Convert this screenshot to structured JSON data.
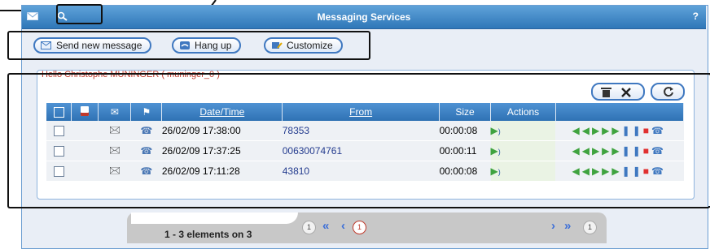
{
  "window": {
    "title": "Messaging Services",
    "help": "?"
  },
  "toolbar": {
    "send_label": "Send new message",
    "hangup_label": "Hang up",
    "customize_label": "Customize"
  },
  "greeting": "Hello Christophe MUNINGER ( muninger_0 )",
  "table": {
    "headers": {
      "date": "Date/Time",
      "from": "From",
      "size": "Size",
      "actions": "Actions"
    },
    "rows": [
      {
        "date": "26/02/09 17:38:00",
        "from": "78353",
        "size": "00:00:08"
      },
      {
        "date": "26/02/09 17:37:25",
        "from": "00630074761",
        "size": "00:00:11"
      },
      {
        "date": "26/02/09 17:11:28",
        "from": "43810",
        "size": "00:00:08"
      }
    ]
  },
  "pager": {
    "summary": "1 - 3 elements on 3",
    "first_page": "1",
    "current_page": "1",
    "last_page": "1"
  },
  "colors": {
    "accent": "#2f77b8",
    "greeting": "#c0392b",
    "link": "#233b8e"
  }
}
